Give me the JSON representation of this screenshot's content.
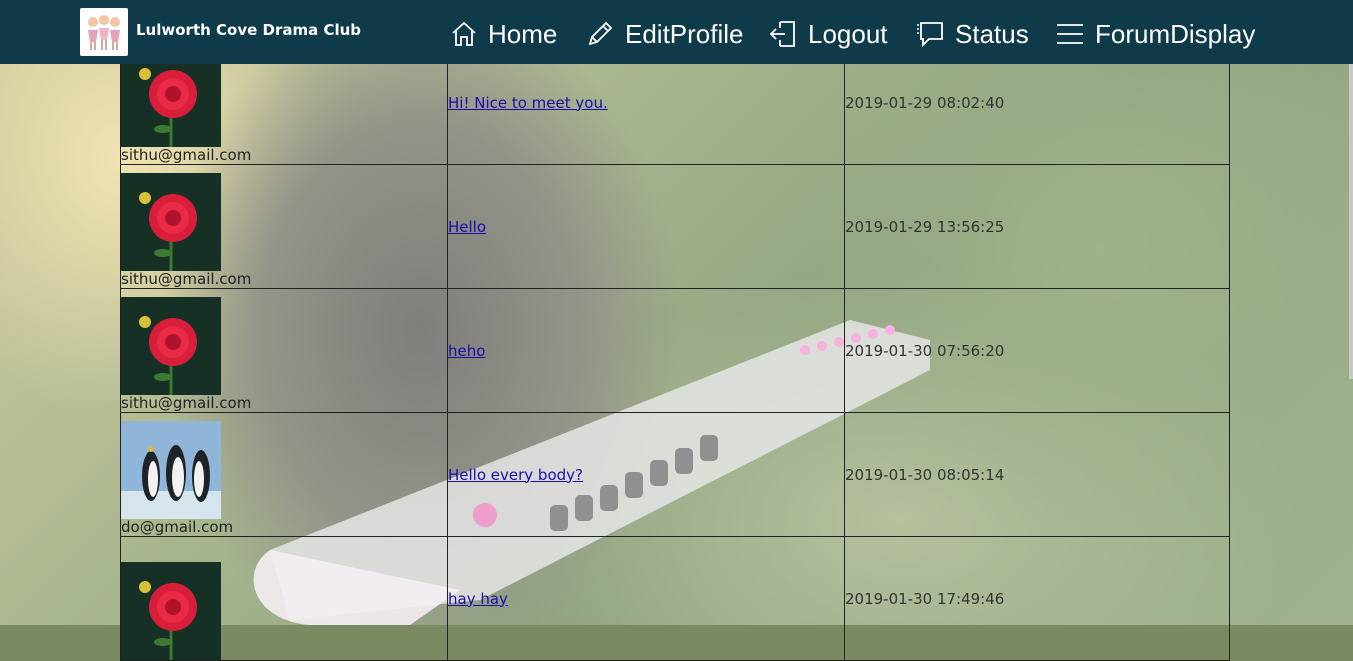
{
  "header": {
    "brand": "Lulworth Cove Drama Club",
    "nav": [
      {
        "label": "Home",
        "icon": "home-icon"
      },
      {
        "label": "EditProfile",
        "icon": "pencil-icon"
      },
      {
        "label": "Logout",
        "icon": "logout-icon"
      },
      {
        "label": "Status",
        "icon": "chat-icon"
      },
      {
        "label": "ForumDisplay",
        "icon": "menu-icon"
      }
    ]
  },
  "posts": [
    {
      "email": "sithu@gmail.com",
      "avatar": "red-flower",
      "message": "Hi! Nice to meet you.",
      "date": "2019-01-29 08:02:40"
    },
    {
      "email": "sithu@gmail.com",
      "avatar": "red-flower",
      "message": "Hello",
      "date": "2019-01-29 13:56:25"
    },
    {
      "email": "sithu@gmail.com",
      "avatar": "red-flower",
      "message": "heho",
      "date": "2019-01-30 07:56:20"
    },
    {
      "email": "do@gmail.com",
      "avatar": "penguins",
      "message": "Hello every body?",
      "date": "2019-01-30 08:05:14"
    },
    {
      "email": "",
      "avatar": "red-flower",
      "message": "hay hay",
      "date": "2019-01-30 17:49:46"
    }
  ],
  "colors": {
    "header": "#0e3a4a",
    "link": "#1a0dab"
  }
}
